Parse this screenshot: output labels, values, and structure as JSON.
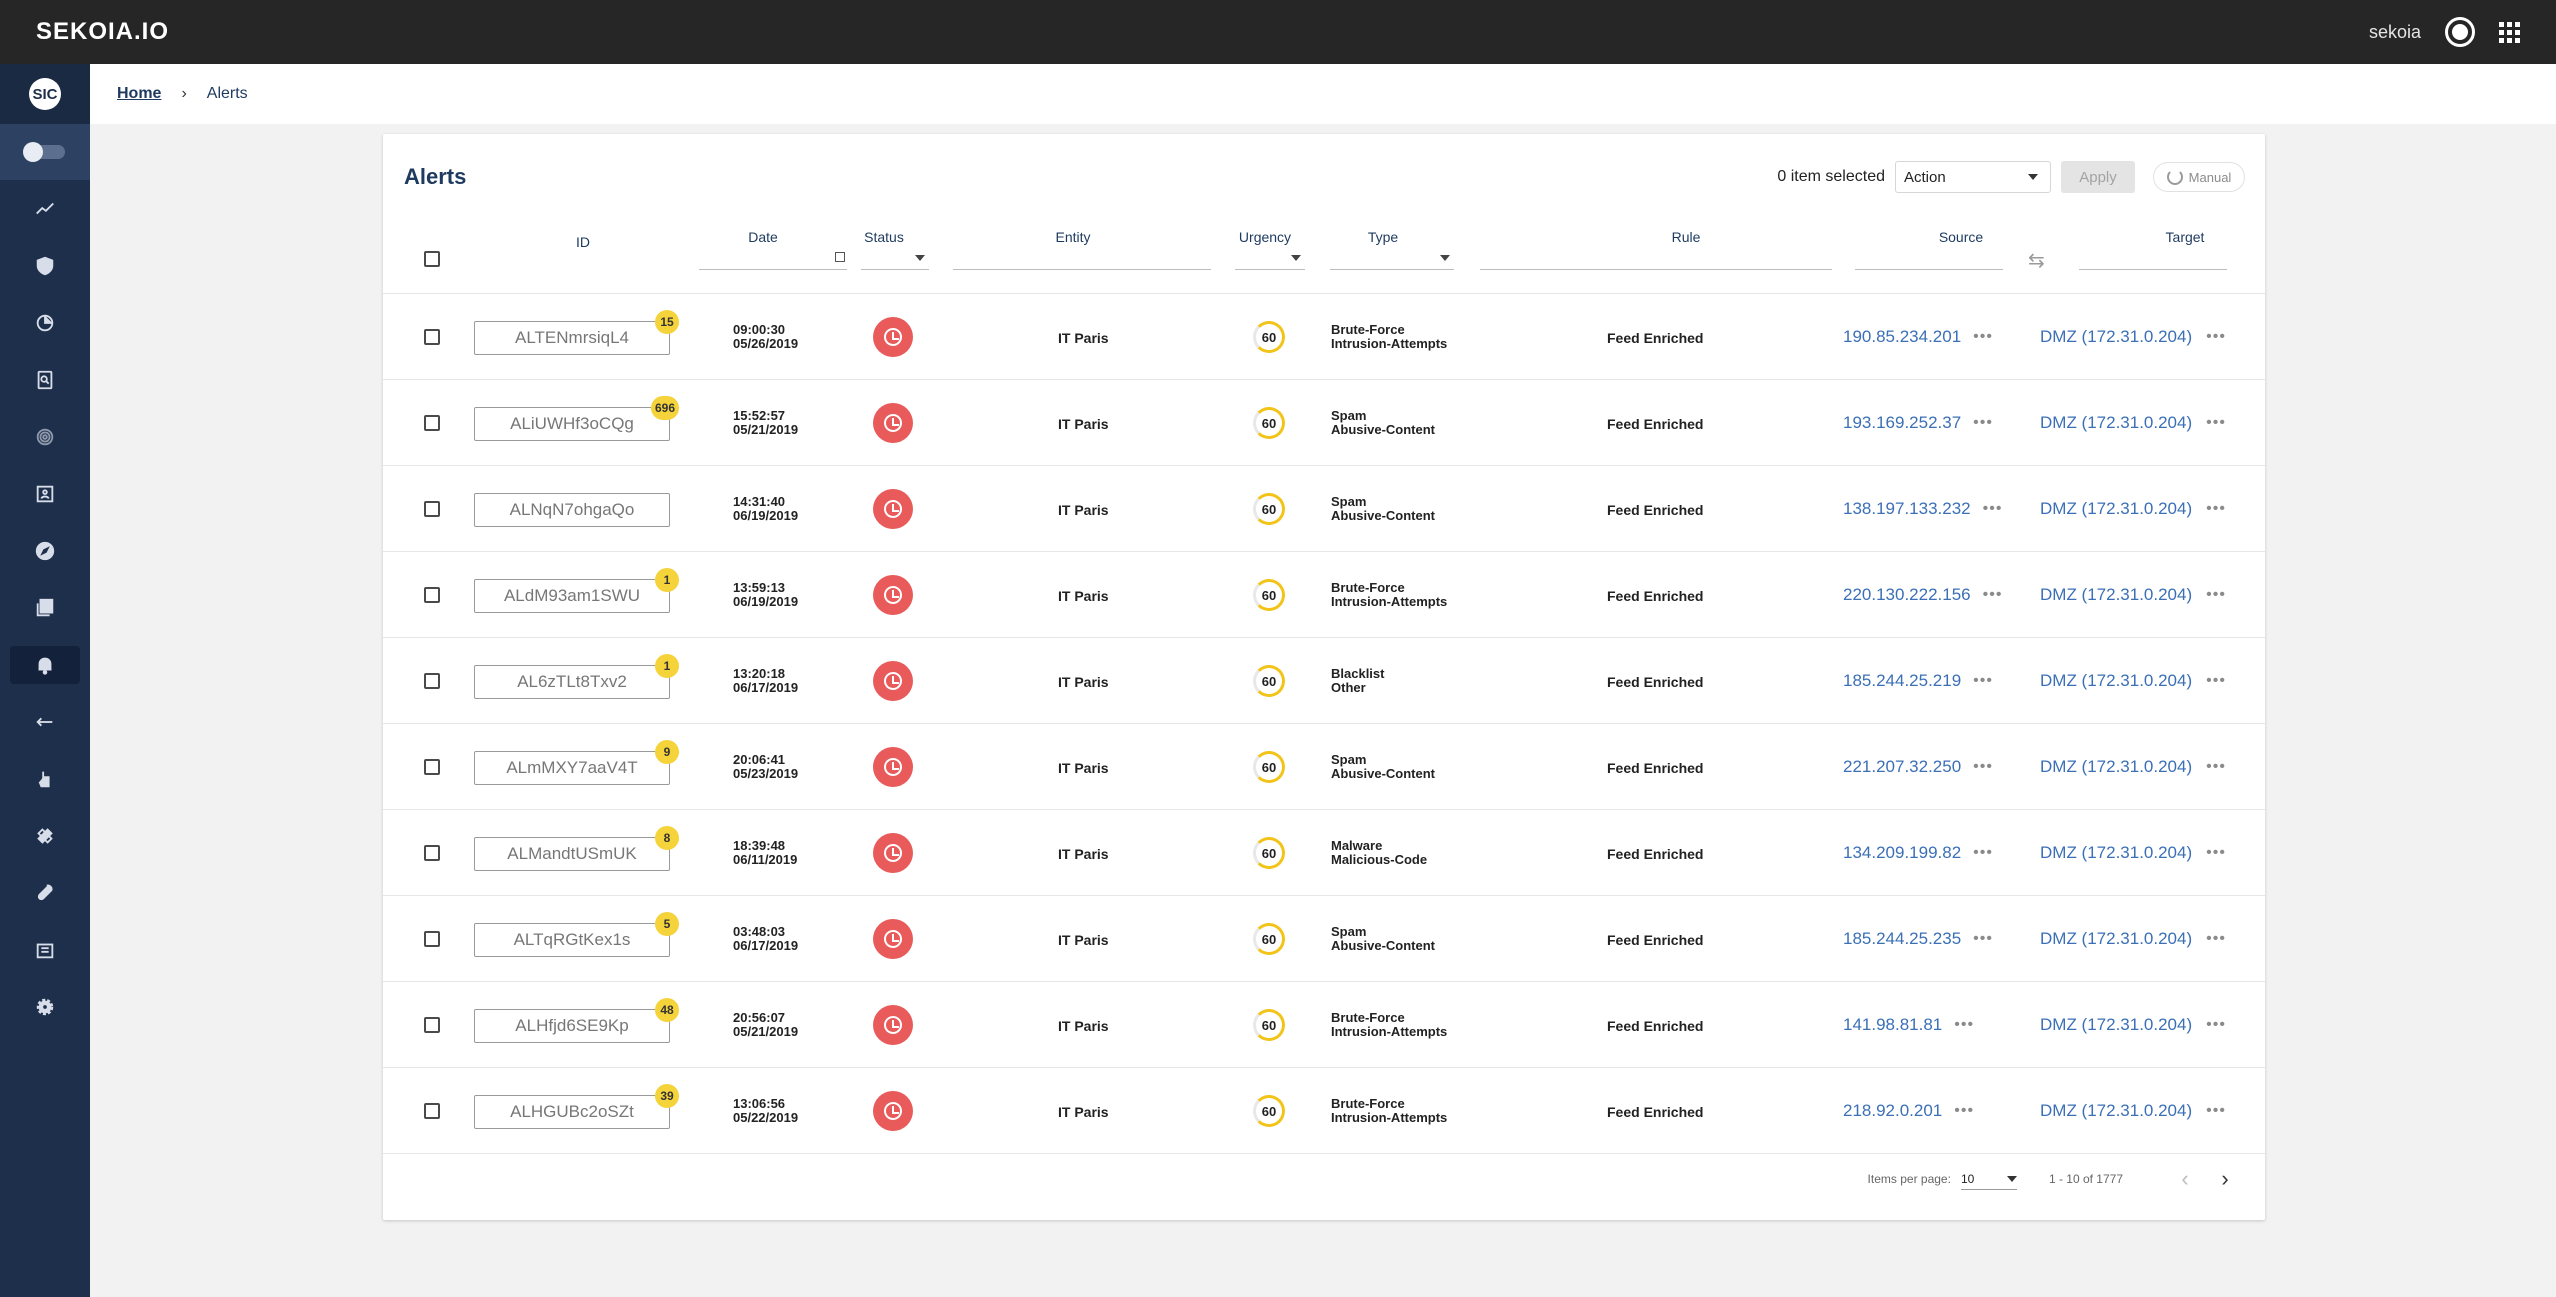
{
  "app": {
    "brand": "SEKOIA.IO",
    "username": "sekoia",
    "side_logo": "SIC"
  },
  "breadcrumb": {
    "home": "Home",
    "separator": "›",
    "current": "Alerts"
  },
  "alerts": {
    "title": "Alerts",
    "selected_count": "0 item selected",
    "action_select": "Action",
    "apply": "Apply",
    "manual": "Manual",
    "columns": {
      "id": "ID",
      "date": "Date",
      "status": "Status",
      "entity": "Entity",
      "urgency": "Urgency",
      "type": "Type",
      "rule": "Rule",
      "source": "Source",
      "target": "Target"
    },
    "rows": [
      {
        "id": "ALTENmrsiqL4",
        "badge": "15",
        "time": "09:00:30",
        "date": "05/26/2019",
        "entity": "IT Paris",
        "urgency": "60",
        "type1": "Brute-Force",
        "type2": "Intrusion-Attempts",
        "rule": "Feed Enriched",
        "source": "190.85.234.201",
        "target": "DMZ (172.31.0.204)"
      },
      {
        "id": "ALiUWHf3oCQg",
        "badge": "696",
        "time": "15:52:57",
        "date": "05/21/2019",
        "entity": "IT Paris",
        "urgency": "60",
        "type1": "Spam",
        "type2": "Abusive-Content",
        "rule": "Feed Enriched",
        "source": "193.169.252.37",
        "target": "DMZ (172.31.0.204)"
      },
      {
        "id": "ALNqN7ohgaQo",
        "badge": "",
        "time": "14:31:40",
        "date": "06/19/2019",
        "entity": "IT Paris",
        "urgency": "60",
        "type1": "Spam",
        "type2": "Abusive-Content",
        "rule": "Feed Enriched",
        "source": "138.197.133.232",
        "target": "DMZ (172.31.0.204)"
      },
      {
        "id": "ALdM93am1SWU",
        "badge": "1",
        "time": "13:59:13",
        "date": "06/19/2019",
        "entity": "IT Paris",
        "urgency": "60",
        "type1": "Brute-Force",
        "type2": "Intrusion-Attempts",
        "rule": "Feed Enriched",
        "source": "220.130.222.156",
        "target": "DMZ (172.31.0.204)"
      },
      {
        "id": "AL6zTLt8Txv2",
        "badge": "1",
        "time": "13:20:18",
        "date": "06/17/2019",
        "entity": "IT Paris",
        "urgency": "60",
        "type1": "Blacklist",
        "type2": "Other",
        "rule": "Feed Enriched",
        "source": "185.244.25.219",
        "target": "DMZ (172.31.0.204)"
      },
      {
        "id": "ALmMXY7aaV4T",
        "badge": "9",
        "time": "20:06:41",
        "date": "05/23/2019",
        "entity": "IT Paris",
        "urgency": "60",
        "type1": "Spam",
        "type2": "Abusive-Content",
        "rule": "Feed Enriched",
        "source": "221.207.32.250",
        "target": "DMZ (172.31.0.204)"
      },
      {
        "id": "ALMandtUSmUK",
        "badge": "8",
        "time": "18:39:48",
        "date": "06/11/2019",
        "entity": "IT Paris",
        "urgency": "60",
        "type1": "Malware",
        "type2": "Malicious-Code",
        "rule": "Feed Enriched",
        "source": "134.209.199.82",
        "target": "DMZ (172.31.0.204)"
      },
      {
        "id": "ALTqRGtKex1s",
        "badge": "5",
        "time": "03:48:03",
        "date": "06/17/2019",
        "entity": "IT Paris",
        "urgency": "60",
        "type1": "Spam",
        "type2": "Abusive-Content",
        "rule": "Feed Enriched",
        "source": "185.244.25.235",
        "target": "DMZ (172.31.0.204)"
      },
      {
        "id": "ALHfjd6SE9Kp",
        "badge": "48",
        "time": "20:56:07",
        "date": "05/21/2019",
        "entity": "IT Paris",
        "urgency": "60",
        "type1": "Brute-Force",
        "type2": "Intrusion-Attempts",
        "rule": "Feed Enriched",
        "source": "141.98.81.81",
        "target": "DMZ (172.31.0.204)"
      },
      {
        "id": "ALHGUBc2oSZt",
        "badge": "39",
        "time": "13:06:56",
        "date": "05/22/2019",
        "entity": "IT Paris",
        "urgency": "60",
        "type1": "Brute-Force",
        "type2": "Intrusion-Attempts",
        "rule": "Feed Enriched",
        "source": "218.92.0.201",
        "target": "DMZ (172.31.0.204)"
      }
    ],
    "paginator": {
      "per_page_label": "Items per page:",
      "per_page_value": "10",
      "range": "1 - 10 of 1777"
    }
  },
  "sidebar_icons": [
    "dashboard-trend-icon",
    "shield-icon",
    "pie-chart-icon",
    "investigation-icon",
    "fingerprint-icon",
    "assets-icon",
    "compass-icon",
    "library-icon",
    "bell-icon",
    "integrations-icon",
    "touch-icon",
    "operations-icon",
    "wrench-icon",
    "building-icon",
    "settings-icon"
  ],
  "colors": {
    "topbar": "#262626",
    "sidebar": "#1e2f4b",
    "status_red": "#e95a5a",
    "badge_yellow": "#f5d33a",
    "link_blue": "#3b6fb6",
    "title_navy": "#1e3a5f"
  }
}
